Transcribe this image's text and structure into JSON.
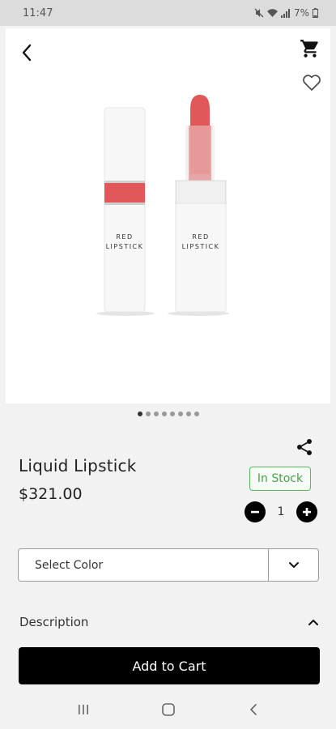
{
  "status_bar": {
    "time": "11:47",
    "battery": "7%"
  },
  "icons": {
    "back": "chevron-left-icon",
    "cart": "cart-icon",
    "favorite": "heart-icon",
    "share": "share-icon",
    "decrease": "minus-icon",
    "increase": "plus-icon",
    "dropdown": "chevron-down-icon",
    "collapse": "chevron-up-icon"
  },
  "product": {
    "name": "Liquid Lipstick",
    "price": "$321.00",
    "stock_status": "In Stock",
    "quantity": "1",
    "image_label_line1": "RED",
    "image_label_line2": "LIPSTICK"
  },
  "carousel": {
    "total": 8,
    "active_index": 0
  },
  "color_select": {
    "placeholder": "Select Color"
  },
  "description": {
    "label": "Description"
  },
  "actions": {
    "add_to_cart": "Add to Cart"
  },
  "colors": {
    "stock": "#4aa24a",
    "primary": "#000000",
    "lipstick": "#e05858"
  }
}
